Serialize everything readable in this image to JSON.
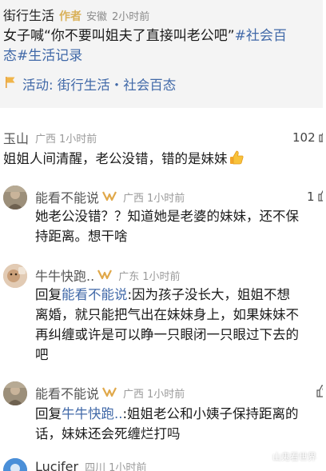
{
  "post": {
    "author": "街行生活",
    "author_tag": "作者",
    "location": "安徽",
    "time": "2小时前",
    "line1_text": "女子喊“你不要叫姐夫了直接叫老公吧”",
    "line1_tag": "#社会百",
    "line2_tag": "态#生活记录",
    "activity": "活动: 街行生活・社会百态"
  },
  "comments": [
    {
      "name": "玉山",
      "region": "广西",
      "time": "1小时前",
      "likes": "102",
      "text": "姐姐人间清醒，老公没错，错的是妹妹",
      "emoji": "thumbs-up-icon"
    },
    {
      "name": "能看不能说",
      "region": "广西",
      "time": "1小时前",
      "likes": "1",
      "line1": "她老公没错？？知道她是老婆的妹妹，还不保",
      "line2": "持距离。想干啥"
    },
    {
      "name": "牛牛快跑..",
      "region": "广东",
      "time": "1小时前",
      "reply_prefix": "回复",
      "reply_to": "能看不能说",
      "line1_rest": ":因为孩子没长大，姐姐不想",
      "line2": "离婚，就只能把气出在妹妹身上，如果妹妹不",
      "line3": "再纠缠或许是可以睁一只眼闭一只眼过下去的",
      "line4": "吧"
    },
    {
      "name": "能看不能说",
      "region": "广西",
      "time": "1小时前",
      "reply_prefix": "回复",
      "reply_to": "牛牛快跑..",
      "line1_rest": ":姐姐老公和小姨子保持距离的",
      "line2": "话，妹妹还会死缠烂打吗"
    },
    {
      "name": "Lucifer",
      "region": "四川",
      "time": "1小时前"
    }
  ],
  "watermark": "山鬼看世界",
  "colors": {
    "link_blue": "#4169a8",
    "vip_gold": "#e0a84a",
    "author_gold": "#d9b15a",
    "post_bg": "#f4f4f4"
  }
}
